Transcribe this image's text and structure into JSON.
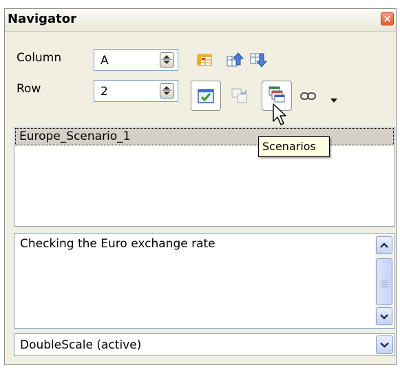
{
  "window": {
    "title": "Navigator",
    "close_glyph": "×"
  },
  "controls": {
    "column_label": "Column",
    "column_value": "A",
    "row_label": "Row",
    "row_value": "2"
  },
  "toolbar": {
    "icons": [
      "data-ranges-icon",
      "start-icon",
      "end-icon",
      "contents-icon",
      "toggle-icon",
      "scenarios-icon",
      "drag-mode-icon",
      "drag-mode-dropdown-icon"
    ]
  },
  "scenario_list": {
    "items": [
      "Europe_Scenario_1"
    ]
  },
  "description": {
    "text": "Checking the Euro exchange rate"
  },
  "document_select": {
    "value": "DoubleScale (active)"
  },
  "tooltip": {
    "text": "Scenarios"
  },
  "colors": {
    "window_bg": "#f1efe2",
    "selection": "#d4d0c8",
    "tooltip_bg": "#ffffe1",
    "close": "#e05b2f"
  }
}
